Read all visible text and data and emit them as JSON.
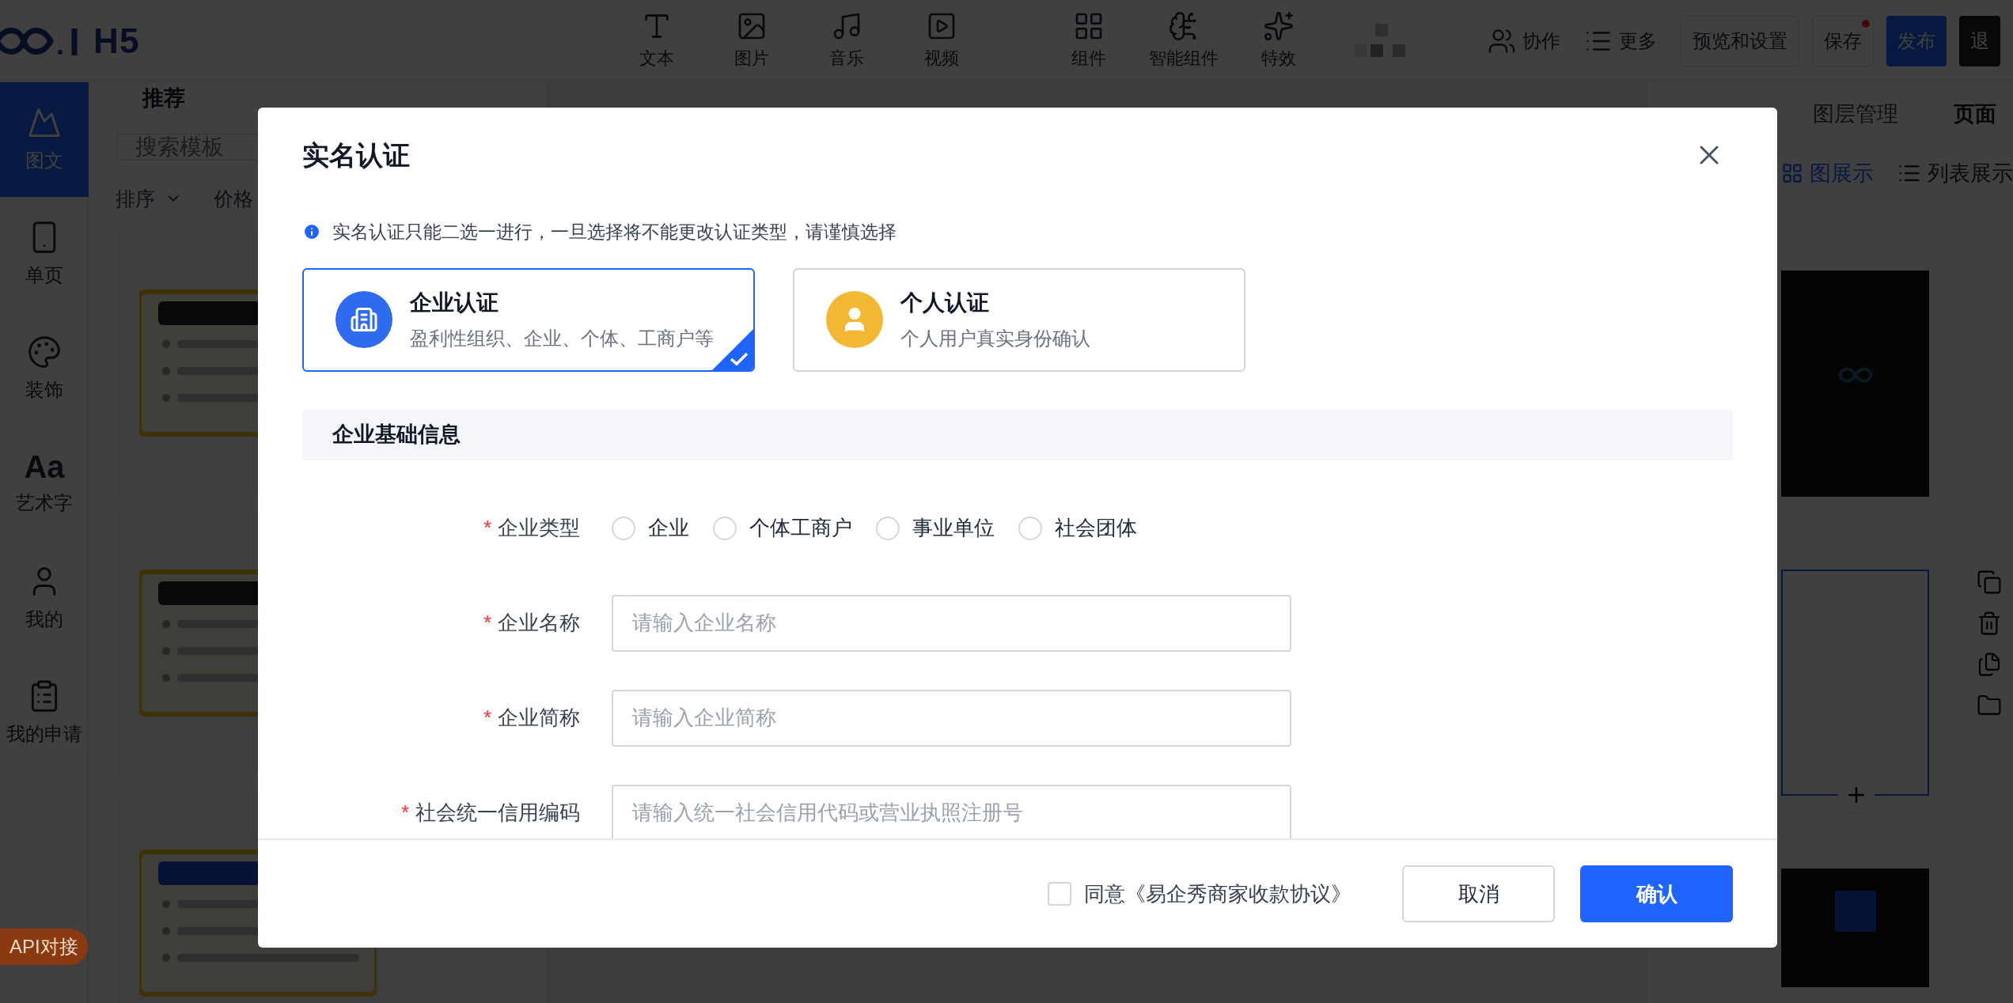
{
  "top_bar": {
    "logo": "H5",
    "tools": [
      {
        "kind": "text",
        "label": "文本"
      },
      {
        "kind": "image",
        "label": "图片"
      },
      {
        "kind": "music",
        "label": "音乐"
      },
      {
        "kind": "video",
        "label": "视频"
      },
      {
        "kind": "components",
        "label": "组件"
      },
      {
        "kind": "ai",
        "label": "智能组件"
      },
      {
        "kind": "effects",
        "label": "特效"
      }
    ],
    "actions": [
      {
        "kind": "collab",
        "label": "协作"
      },
      {
        "kind": "more",
        "label": "更多"
      }
    ],
    "buttons": [
      {
        "kind": "outline",
        "label": "预览和设置",
        "dot": false
      },
      {
        "kind": "outline",
        "label": "保存",
        "dot": true
      },
      {
        "kind": "primary",
        "label": "发布",
        "dot": false
      },
      {
        "kind": "dark",
        "label": "退",
        "dot": false
      }
    ]
  },
  "sidebar": {
    "items": [
      {
        "kind": "image-text",
        "label": "图文",
        "selected": true
      },
      {
        "kind": "page",
        "label": "单页",
        "selected": false
      },
      {
        "kind": "decor",
        "label": "装饰",
        "selected": false
      },
      {
        "kind": "art-text",
        "label": "艺术字",
        "icon_text": "Aa",
        "selected": false
      },
      {
        "kind": "mine",
        "label": "我的",
        "selected": false
      },
      {
        "kind": "apply",
        "label": "我的申请",
        "selected": false
      }
    ],
    "badge": "API对接"
  },
  "template_panel": {
    "tabs": [
      {
        "label": "推荐",
        "selected": true
      }
    ],
    "search": {
      "placeholder": "搜索模板"
    },
    "filters": [
      {
        "label": "排序",
        "dropdown": true
      },
      {
        "label": "价格",
        "dropdown": false
      }
    ]
  },
  "right_panel": {
    "tabs": [
      {
        "label": "图层管理",
        "selected": false
      },
      {
        "label": "页面",
        "selected": true
      }
    ],
    "view_modes": [
      {
        "kind": "grid",
        "label": "图展示",
        "selected": true
      },
      {
        "kind": "list",
        "label": "列表展示",
        "selected": false
      }
    ],
    "pages": [
      {
        "kind": "logo",
        "selected": false
      },
      {
        "kind": "blank",
        "selected": true
      },
      {
        "kind": "card",
        "selected": false
      }
    ]
  },
  "dialog": {
    "title": "实名认证",
    "notice": "实名认证只能二选一进行，一旦选择将不能更改认证类型，请谨慎选择",
    "auth_types": [
      {
        "kind": "enterprise",
        "title": "企业认证",
        "description": "盈利性组织、企业、个体、工商户等",
        "selected": true
      },
      {
        "kind": "personal",
        "title": "个人认证",
        "description": "个人用户真实身份确认",
        "selected": false
      }
    ],
    "section_title": "企业基础信息",
    "required_mark": "*",
    "fields": [
      {
        "kind": "radio",
        "label": "企业类型",
        "required": true,
        "options": [
          {
            "label": "企业",
            "selected": false
          },
          {
            "label": "个体工商户",
            "selected": false
          },
          {
            "label": "事业单位",
            "selected": false
          },
          {
            "label": "社会团体",
            "selected": false
          }
        ]
      },
      {
        "kind": "input",
        "label": "企业名称",
        "required": true,
        "placeholder": "请输入企业名称"
      },
      {
        "kind": "input",
        "label": "企业简称",
        "required": true,
        "placeholder": "请输入企业简称"
      },
      {
        "kind": "input",
        "label": "社会统一信用编码",
        "required": true,
        "placeholder": "请输入统一社会信用代码或营业执照注册号"
      }
    ],
    "agreement": {
      "label": "同意《易企秀商家收款协议》",
      "checked": false
    },
    "buttons": [
      {
        "kind": "secondary",
        "label": "取消"
      },
      {
        "kind": "primary",
        "label": "确认"
      }
    ]
  }
}
